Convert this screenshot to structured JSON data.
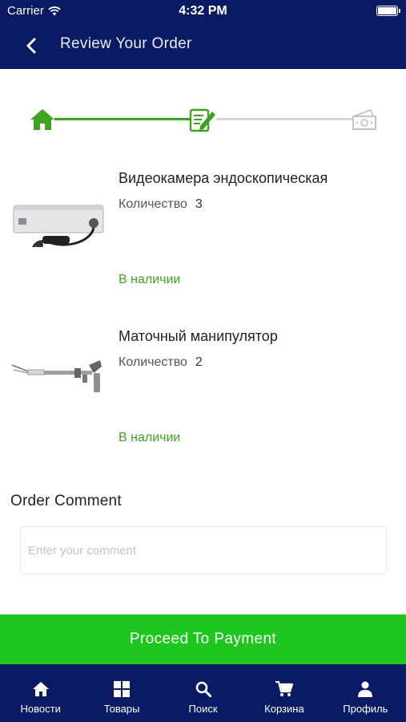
{
  "status_bar": {
    "carrier": "Carrier",
    "time": "4:32 PM"
  },
  "header": {
    "title": "Review Your Order"
  },
  "checkout_steps": [
    {
      "name": "cart",
      "icon": "home-icon",
      "state": "complete"
    },
    {
      "name": "review",
      "icon": "edit-document-icon",
      "state": "current"
    },
    {
      "name": "payment",
      "icon": "money-icon",
      "state": "pending"
    }
  ],
  "order_items": [
    {
      "name": "Видеокамера эндоскопическая",
      "quantity_label": "Количество",
      "quantity": "3",
      "availability": "В наличии"
    },
    {
      "name": "Маточный манипулятор",
      "quantity_label": "Количество",
      "quantity": "2",
      "availability": "В наличии"
    }
  ],
  "comment": {
    "heading": "Order Comment",
    "placeholder": "Enter your comment",
    "value": ""
  },
  "actions": {
    "proceed_label": "Proceed To Payment"
  },
  "tab_bar": [
    {
      "label": "Новости",
      "icon": "home-icon"
    },
    {
      "label": "Товары",
      "icon": "grid-icon"
    },
    {
      "label": "Поиск",
      "icon": "search-icon"
    },
    {
      "label": "Корзина",
      "icon": "cart-icon"
    },
    {
      "label": "Профиль",
      "icon": "person-icon"
    }
  ],
  "colors": {
    "primary_navy": "#0a1a63",
    "accent_green": "#3ea31e",
    "button_green": "#1dc71d"
  }
}
